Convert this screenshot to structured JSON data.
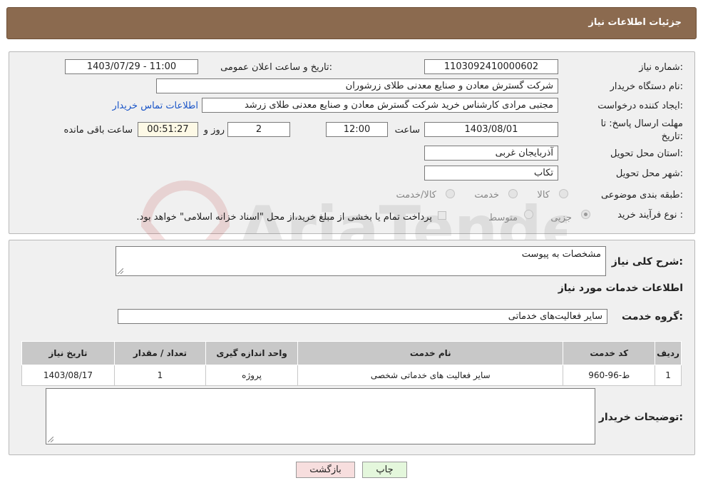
{
  "header": {
    "title": "جزئیات اطلاعات نیاز"
  },
  "labels": {
    "need_number": "شماره نیاز:",
    "announce_datetime": "تاریخ و ساعت اعلان عمومی:",
    "buyer_org": "نام دستگاه خریدار:",
    "requester": "ایجاد کننده درخواست:",
    "deadline_line1": "مهلت ارسال پاسخ: تا",
    "deadline_line2": "تاریخ:",
    "hour": "ساعت",
    "days_and": "روز و",
    "remaining": "ساعت باقی مانده",
    "province": "استان محل تحویل:",
    "city": "شهر محل تحویل:",
    "category": "طبقه بندی موضوعی:",
    "process_type": "نوع فرآیند خرید :",
    "general_desc": "شرح کلی نیاز:",
    "services_info": "اطلاعات خدمات مورد نیاز",
    "service_group": "گروه خدمت:",
    "buyer_notes": "توضیحات خریدار:"
  },
  "fields": {
    "need_number": "1103092410000602",
    "announce_datetime": "1403/07/29 - 11:00",
    "buyer_org": "شرکت گسترش معادن و صنایع معدنی طلای زرشوران",
    "requester": "مجتبی مرادی کارشناس خرید شرکت گسترش معادن و صنایع معدنی طلای زرشد",
    "contact_link": "اطلاعات تماس خریدار",
    "deadline_date": "1403/08/01",
    "deadline_time": "12:00",
    "days": "2",
    "remaining_time": "00:51:27",
    "province": "آذربایجان غربی",
    "city": "تکاب",
    "general_desc": "مشخصات به پیوست",
    "service_group": "سایر فعالیت‌های خدماتی",
    "buyer_notes": ""
  },
  "category_options": [
    {
      "label": "کالا",
      "checked": false
    },
    {
      "label": "خدمت",
      "checked": false
    },
    {
      "label": "کالا/خدمت",
      "checked": false
    }
  ],
  "process_options": [
    {
      "label": "جزیی",
      "checked": true
    },
    {
      "label": "متوسط",
      "checked": false
    }
  ],
  "payment_note": "پرداخت تمام یا بخشی از مبلغ خرید،از محل \"اسناد خزانه اسلامی\" خواهد بود.",
  "table": {
    "headers": [
      "ردیف",
      "کد خدمت",
      "نام خدمت",
      "واحد اندازه گیری",
      "تعداد / مقدار",
      "تاریخ نیاز"
    ],
    "rows": [
      [
        "1",
        "ط-96-960",
        "سایر فعالیت های خدماتی شخصی",
        "پروژه",
        "1",
        "1403/08/17"
      ]
    ]
  },
  "buttons": {
    "print": "چاپ",
    "back": "بازگشت"
  },
  "watermark": {
    "text": "AriaTender.neT"
  },
  "colors": {
    "header_bg": "#8b6a4f",
    "print_btn": "#e4f7dc",
    "back_btn": "#f7dede",
    "link": "#1a55c8"
  }
}
